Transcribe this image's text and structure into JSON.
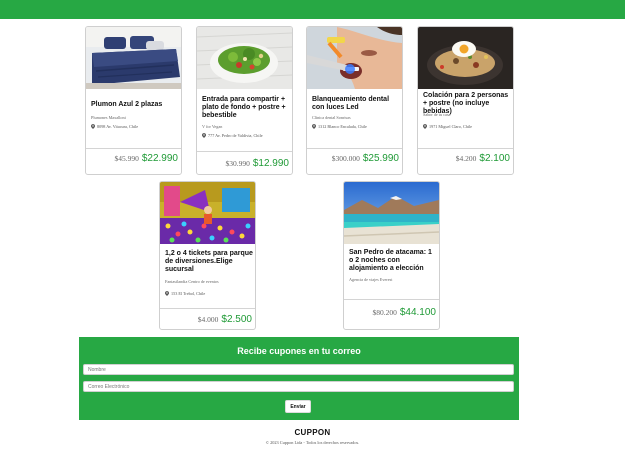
{
  "header": {
    "color": "#27a844"
  },
  "offers": [
    {
      "title": "Plumon Azul 2 plazas",
      "merchant": "Plumones Maxalloni",
      "address": "8098 Av. Vitacura, Chile",
      "old_price": "$45.990",
      "new_price": "$22.990",
      "image": "blue-bedding-image"
    },
    {
      "title": "Entrada para compartir + plato de fondo + postre + bebestible",
      "merchant": "V for Vegan",
      "address": "777 Av. Pedro de Valdivia, Chile",
      "old_price": "$30.990",
      "new_price": "$12.990",
      "image": "salad-image"
    },
    {
      "title": "Blanqueamiento dental con luces Led",
      "merchant": "Clínica dental Sonrisas",
      "address": "1312 Blanco Encalada, Chile",
      "old_price": "$300.000",
      "new_price": "$25.990",
      "image": "dental-whitening-image"
    },
    {
      "title": "Colación para 2 personas + postre (no incluye bebidas)",
      "merchant": "Sabor de tu casa",
      "address": "1971 Miguel Claro, Chile",
      "old_price": "$4.200",
      "new_price": "$2.100",
      "image": "rice-egg-dish-image"
    },
    {
      "title": "1,2 o 4 tickets para parque de diversiones.Elige sucursal",
      "merchant": "Fantasilandia Centro de eventos",
      "address": "153 El Trebol, Chile",
      "old_price": "$4.000",
      "new_price": "$2.500",
      "image": "ball-pit-park-image"
    },
    {
      "title": "San Pedro de atacama: 1 o 2 noches con alojamiento a elección",
      "merchant": "Agencia de viajes Everest",
      "address": "",
      "old_price": "$80.200",
      "new_price": "$44.100",
      "image": "atacama-lagoon-image"
    }
  ],
  "newsletter": {
    "title": "Recibe cupones en tu correo",
    "name_placeholder": "Nombre",
    "email_placeholder": "Correo Electrónico",
    "submit_label": "Enviar"
  },
  "footer": {
    "brand": "CUPPON",
    "copyright": "© 2023 Cuppon Ltda - Todos los derechos reservados."
  },
  "colors": {
    "primary": "#27a844",
    "price_green": "#1f9a36"
  }
}
